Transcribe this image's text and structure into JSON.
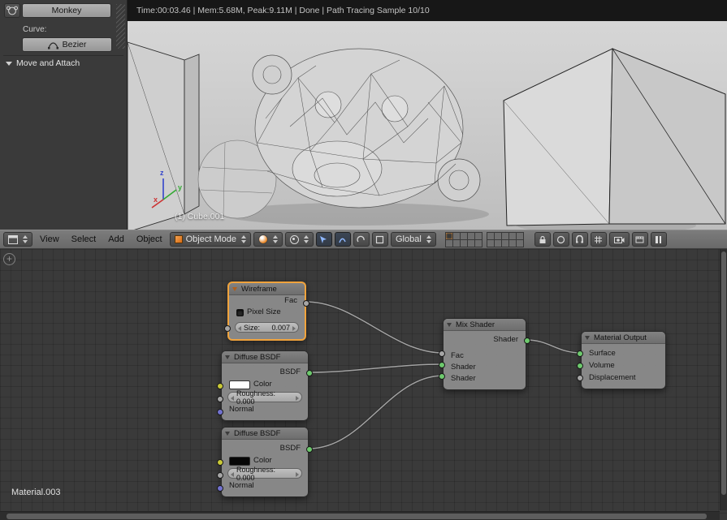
{
  "tool_shelf": {
    "monkey_button": "Monkey",
    "curve_label": "Curve:",
    "bezier_button": "Bezier",
    "move_attach_section": "Move and Attach"
  },
  "viewport": {
    "render_info": "Time:00:03.46 | Mem:5.68M, Peak:9.11M | Done | Path Tracing Sample 10/10",
    "object_label": "(1) Cube.001",
    "axis_x": "x",
    "axis_y": "y",
    "axis_z": "z"
  },
  "header": {
    "menus": [
      {
        "label": "View"
      },
      {
        "label": "Select"
      },
      {
        "label": "Add"
      },
      {
        "label": "Object"
      }
    ],
    "mode_value": "Object Mode",
    "orientation_value": "Global"
  },
  "node_editor": {
    "material_name": "Material.003",
    "wireframe": {
      "title": "Wireframe",
      "output_fac": "Fac",
      "pixel_size": "Pixel Size",
      "size_label": "Size:",
      "size_value": "0.007"
    },
    "diffuse1": {
      "title": "Diffuse BSDF",
      "output_bsdf": "BSDF",
      "color_label": "Color",
      "roughness": "Roughness: 0.000",
      "normal_label": "Normal",
      "swatch": "#ffffff"
    },
    "diffuse2": {
      "title": "Diffuse BSDF",
      "output_bsdf": "BSDF",
      "color_label": "Color",
      "roughness": "Roughness: 0.000",
      "normal_label": "Normal",
      "swatch": "#060606"
    },
    "mix": {
      "title": "Mix Shader",
      "output_shader": "Shader",
      "input_fac": "Fac",
      "input_shader1": "Shader",
      "input_shader2": "Shader"
    },
    "output": {
      "title": "Material Output",
      "input_surface": "Surface",
      "input_volume": "Volume",
      "input_displacement": "Displacement"
    }
  },
  "colors": {
    "socket_shader": "#6dc96d",
    "socket_value": "#a6a6a6",
    "socket_color": "#c9c937",
    "socket_vector": "#7272cf",
    "selection_orange": "#f0a33c",
    "axis_x": "#cc3333",
    "axis_y": "#33aa33",
    "axis_z": "#3344cc"
  }
}
